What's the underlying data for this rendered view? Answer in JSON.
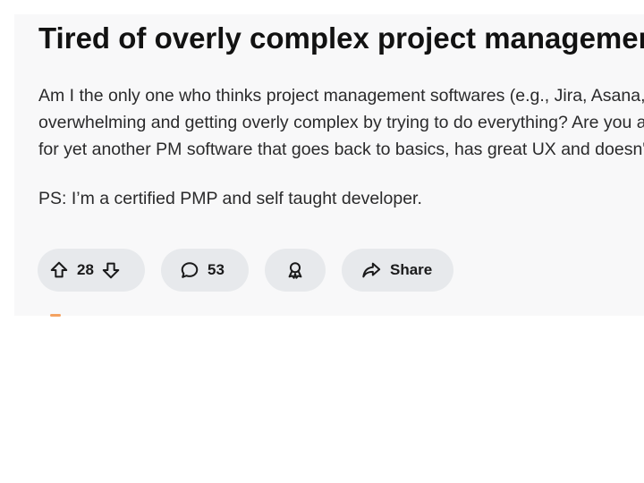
{
  "post": {
    "title": "Tired of overly complex project management softwares",
    "body_lines": [
      "Am I the only one who thinks project management softwares (e.g., Jira, Asana, Monday) are becoming",
      "overwhelming and getting overly complex by trying to do everything? Are you also in the market",
      "for yet another PM software that goes back to basics, has great UX and doesn't cost an arm and a leg?"
    ],
    "ps": "PS: I’m a certified PMP and self taught developer."
  },
  "actions": {
    "upvotes": "28",
    "comments": "53",
    "share_label": "Share"
  },
  "icons": {
    "upvote": "arrow-up-icon",
    "downvote": "arrow-down-icon",
    "comment": "speech-bubble-icon",
    "award": "award-icon",
    "share": "share-arrow-icon"
  },
  "colors": {
    "card_background": "#f8f8f9",
    "pill_background": "#e7e9ec",
    "text": "#1a1a1b"
  }
}
